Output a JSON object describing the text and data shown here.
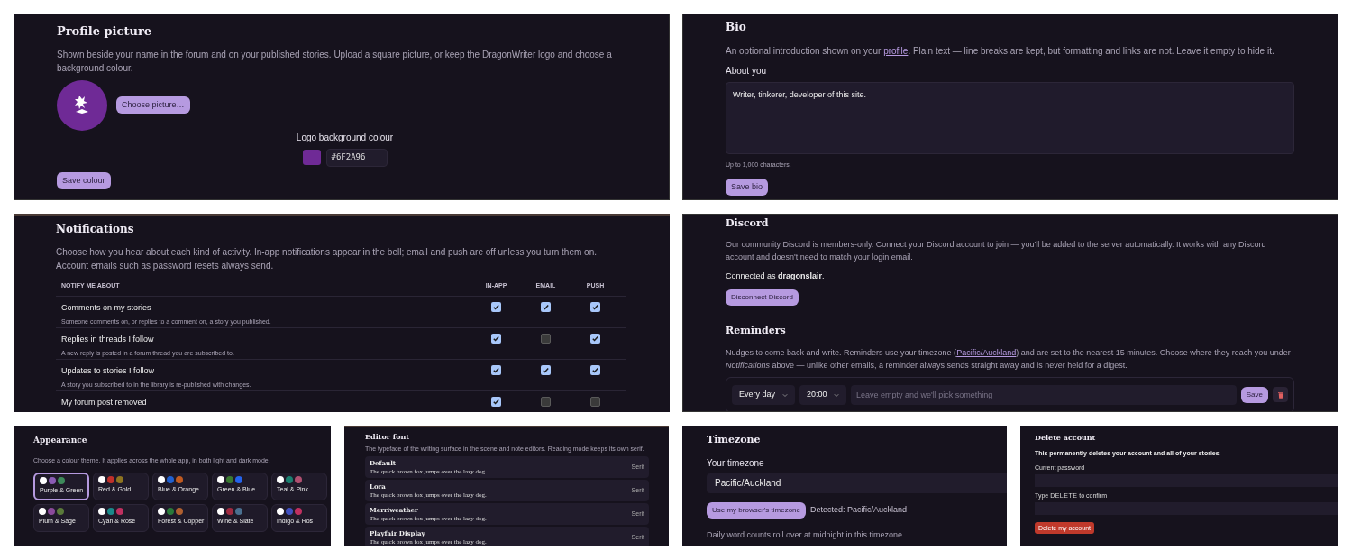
{
  "profile_picture": {
    "title": "Profile picture",
    "description": "Shown beside your name in the forum and on your published stories. Upload a square picture, or keep the DragonWriter logo and choose a background colour.",
    "choose_button": "Choose picture…",
    "colour_label": "Logo background colour",
    "colour_value": "#6F2A96",
    "save_button": "Save colour"
  },
  "bio": {
    "title": "Bio",
    "description_before": "An optional introduction shown on your ",
    "description_link": "profile",
    "description_after": ". Plain text — line breaks are kept, but formatting and links are not. Leave it empty to hide it.",
    "field_label": "About you",
    "value": "Writer, tinkerer, developer of this site.",
    "hint": "Up to 1,000 characters.",
    "save_button": "Save bio"
  },
  "notifications": {
    "title": "Notifications",
    "description": "Choose how you hear about each kind of activity. In-app notifications appear in the bell; email and push are off unless you turn them on. Account emails such as password resets always send.",
    "columns": [
      "NOTIFY ME ABOUT",
      "IN-APP",
      "EMAIL",
      "PUSH"
    ],
    "rows": [
      {
        "title": "Comments on my stories",
        "description": "Someone comments on, or replies to a comment on, a story you published.",
        "in_app": true,
        "email": true,
        "push": true
      },
      {
        "title": "Replies in threads I follow",
        "description": "A new reply is posted in a forum thread you are subscribed to.",
        "in_app": true,
        "email": false,
        "push": true
      },
      {
        "title": "Updates to stories I follow",
        "description": "A story you subscribed to in the library is re-published with changes.",
        "in_app": true,
        "email": true,
        "push": true
      },
      {
        "title": "My forum post removed",
        "in_app": true,
        "email": false,
        "push": false
      }
    ]
  },
  "discord": {
    "title": "Discord",
    "description": "Our community Discord is members-only. Connect your Discord account to join — you'll be added to the server automatically. It works with any Discord account and doesn't need to match your login email.",
    "status": "Connected as **dragonslair**.",
    "button": "Disconnect Discord"
  },
  "reminders": {
    "title": "Reminders",
    "description_before": "Nudges to come back and write. Reminders use your timezone (",
    "description_link": "Pacific/Auckland",
    "description_after": ") and are set to the nearest 15 minutes. Choose where they reach you under *Notifications* above — unlike other emails, a reminder always sends straight away and is never held for a digest.",
    "frequency": "Every day",
    "time": "20:00",
    "placeholder": "Leave empty and we'll pick something",
    "save_button": "Save"
  },
  "appearance": {
    "title": "Appearance",
    "description": "Choose a colour theme. It applies across the whole app, in both light and dark mode.",
    "themes": [
      {
        "name": "Purple & Green",
        "swatches": [
          {
            "color": "#ffffff"
          },
          {
            "color": "#8a5cb5"
          },
          {
            "color": "#3d8a5a"
          }
        ],
        "selected": true
      },
      {
        "name": "Red & Gold",
        "swatches": [
          {
            "color": "#ffffff"
          },
          {
            "color": "#c0302a"
          },
          {
            "color": "#8d7420"
          }
        ],
        "selected": false
      },
      {
        "name": "Blue & Orange",
        "swatches": [
          {
            "color": "#ffffff"
          },
          {
            "color": "#2060d0"
          },
          {
            "color": "#c05a20"
          }
        ],
        "selected": false
      },
      {
        "name": "Green & Blue",
        "swatches": [
          {
            "color": "#ffffff"
          },
          {
            "color": "#3a7a30"
          },
          {
            "color": "#2563eb"
          }
        ],
        "selected": false
      },
      {
        "name": "Teal & Pink",
        "swatches": [
          {
            "color": "#ffffff"
          },
          {
            "color": "#1a8070"
          },
          {
            "color": "#b05070"
          }
        ],
        "selected": false
      },
      {
        "name": "Plum & Sage",
        "swatches": [
          {
            "color": "#ffffff"
          },
          {
            "color": "#8a4a9a"
          },
          {
            "color": "#5a7a3a"
          }
        ],
        "selected": false
      },
      {
        "name": "Cyan & Rose",
        "swatches": [
          {
            "color": "#ffffff"
          },
          {
            "color": "#1a8a8a"
          },
          {
            "color": "#c03060"
          }
        ],
        "selected": false
      },
      {
        "name": "Forest & Copper",
        "swatches": [
          {
            "color": "#ffffff"
          },
          {
            "color": "#2a7a3a"
          },
          {
            "color": "#b06030"
          }
        ],
        "selected": false
      },
      {
        "name": "Wine & Slate",
        "swatches": [
          {
            "color": "#ffffff"
          },
          {
            "color": "#a02a40"
          },
          {
            "color": "#4a7090"
          }
        ],
        "selected": false
      },
      {
        "name": "Indigo & Ros",
        "swatches": [
          {
            "color": "#ffffff"
          },
          {
            "color": "#4050c0"
          },
          {
            "color": "#c03060"
          }
        ],
        "selected": false
      }
    ]
  },
  "editor_font": {
    "title": "Editor font",
    "description": "The typeface of the writing surface in the scene and note editors. Reading mode keeps its own serif.",
    "fonts": [
      {
        "name": "Default",
        "sample": "The quick brown fox jumps over the lazy dog.",
        "tag": "Serif"
      },
      {
        "name": "Lora",
        "sample": "The quick brown fox jumps over the lazy dog.",
        "tag": "Serif"
      },
      {
        "name": "Merriweather",
        "sample": "The quick brown fox jumps over the lazy dog.",
        "tag": "Serif"
      },
      {
        "name": "Playfair Display",
        "sample": "The quick brown fox jumps over the lazy dog.",
        "tag": "Serif"
      }
    ]
  },
  "timezone": {
    "title": "Timezone",
    "field_label": "Your timezone",
    "value": "Pacific/Auckland",
    "button": "Use my browser's timezone",
    "detected": "Detected: Pacific/Auckland",
    "note": "Daily word counts roll over at midnight in this timezone."
  },
  "delete_account": {
    "title": "Delete account",
    "warning": "This permanently deletes your account and all of your stories.",
    "password_label": "Current password",
    "confirm_before": "Type ",
    "confirm_keyword": "DELETE",
    "confirm_after": " to confirm",
    "button": "Delete my account"
  }
}
